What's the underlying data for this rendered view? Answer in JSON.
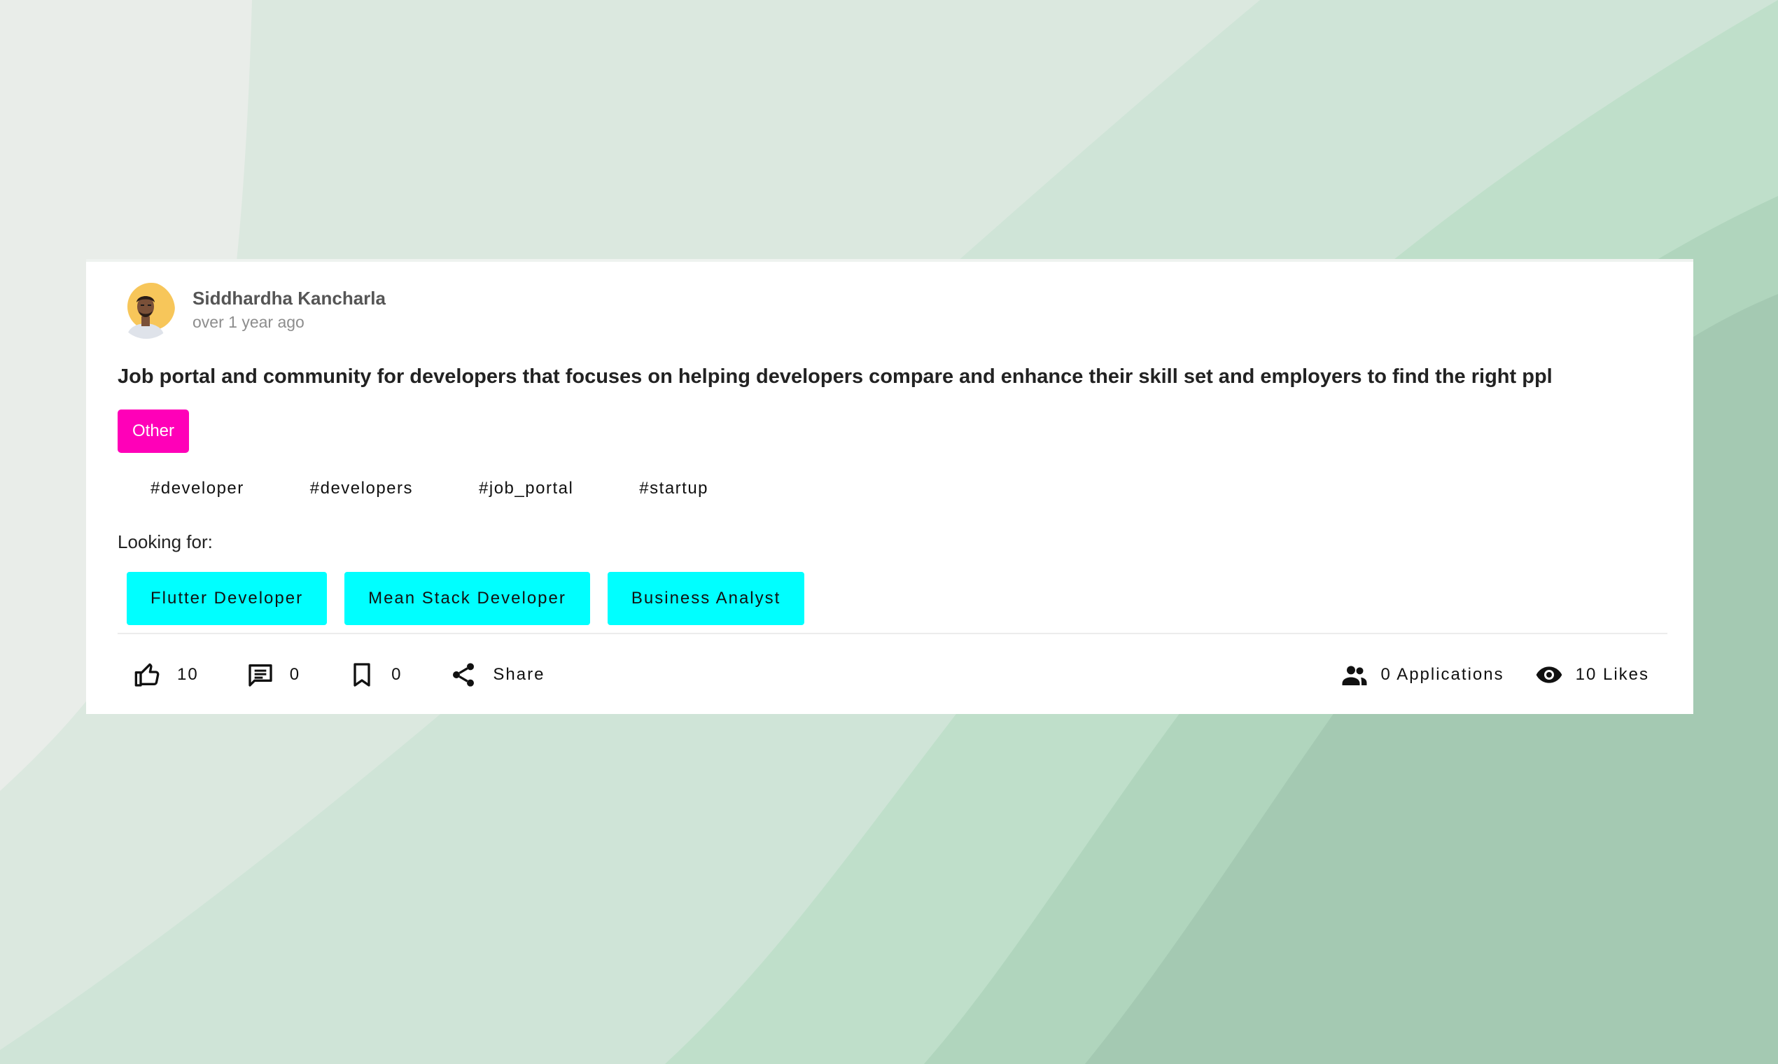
{
  "colors": {
    "category_bg": "#ff00b8",
    "role_bg": "#00ffff",
    "card_bg": "#ffffff"
  },
  "post": {
    "author": "Siddhardha Kancharla",
    "time": "over 1 year ago",
    "text": "Job portal and community for developers that focuses on helping developers compare and enhance their skill set and employers to find the right ppl",
    "category": "Other",
    "tags": [
      "#developer",
      "#developers",
      "#job_portal",
      "#startup"
    ],
    "looking_for_label": "Looking for:",
    "roles": [
      "Flutter Developer",
      "Mean Stack Developer",
      "Business Analyst"
    ]
  },
  "actions": {
    "like_icon": "thumb-up-icon",
    "like_count": "10",
    "comment_icon": "comment-icon",
    "comment_count": "0",
    "bookmark_icon": "bookmark-icon",
    "bookmark_count": "0",
    "share_icon": "share-icon",
    "share_label": "Share"
  },
  "stats": {
    "applications_icon": "people-icon",
    "applications": "0 Applications",
    "views_icon": "eye-icon",
    "likes": "10 Likes"
  }
}
